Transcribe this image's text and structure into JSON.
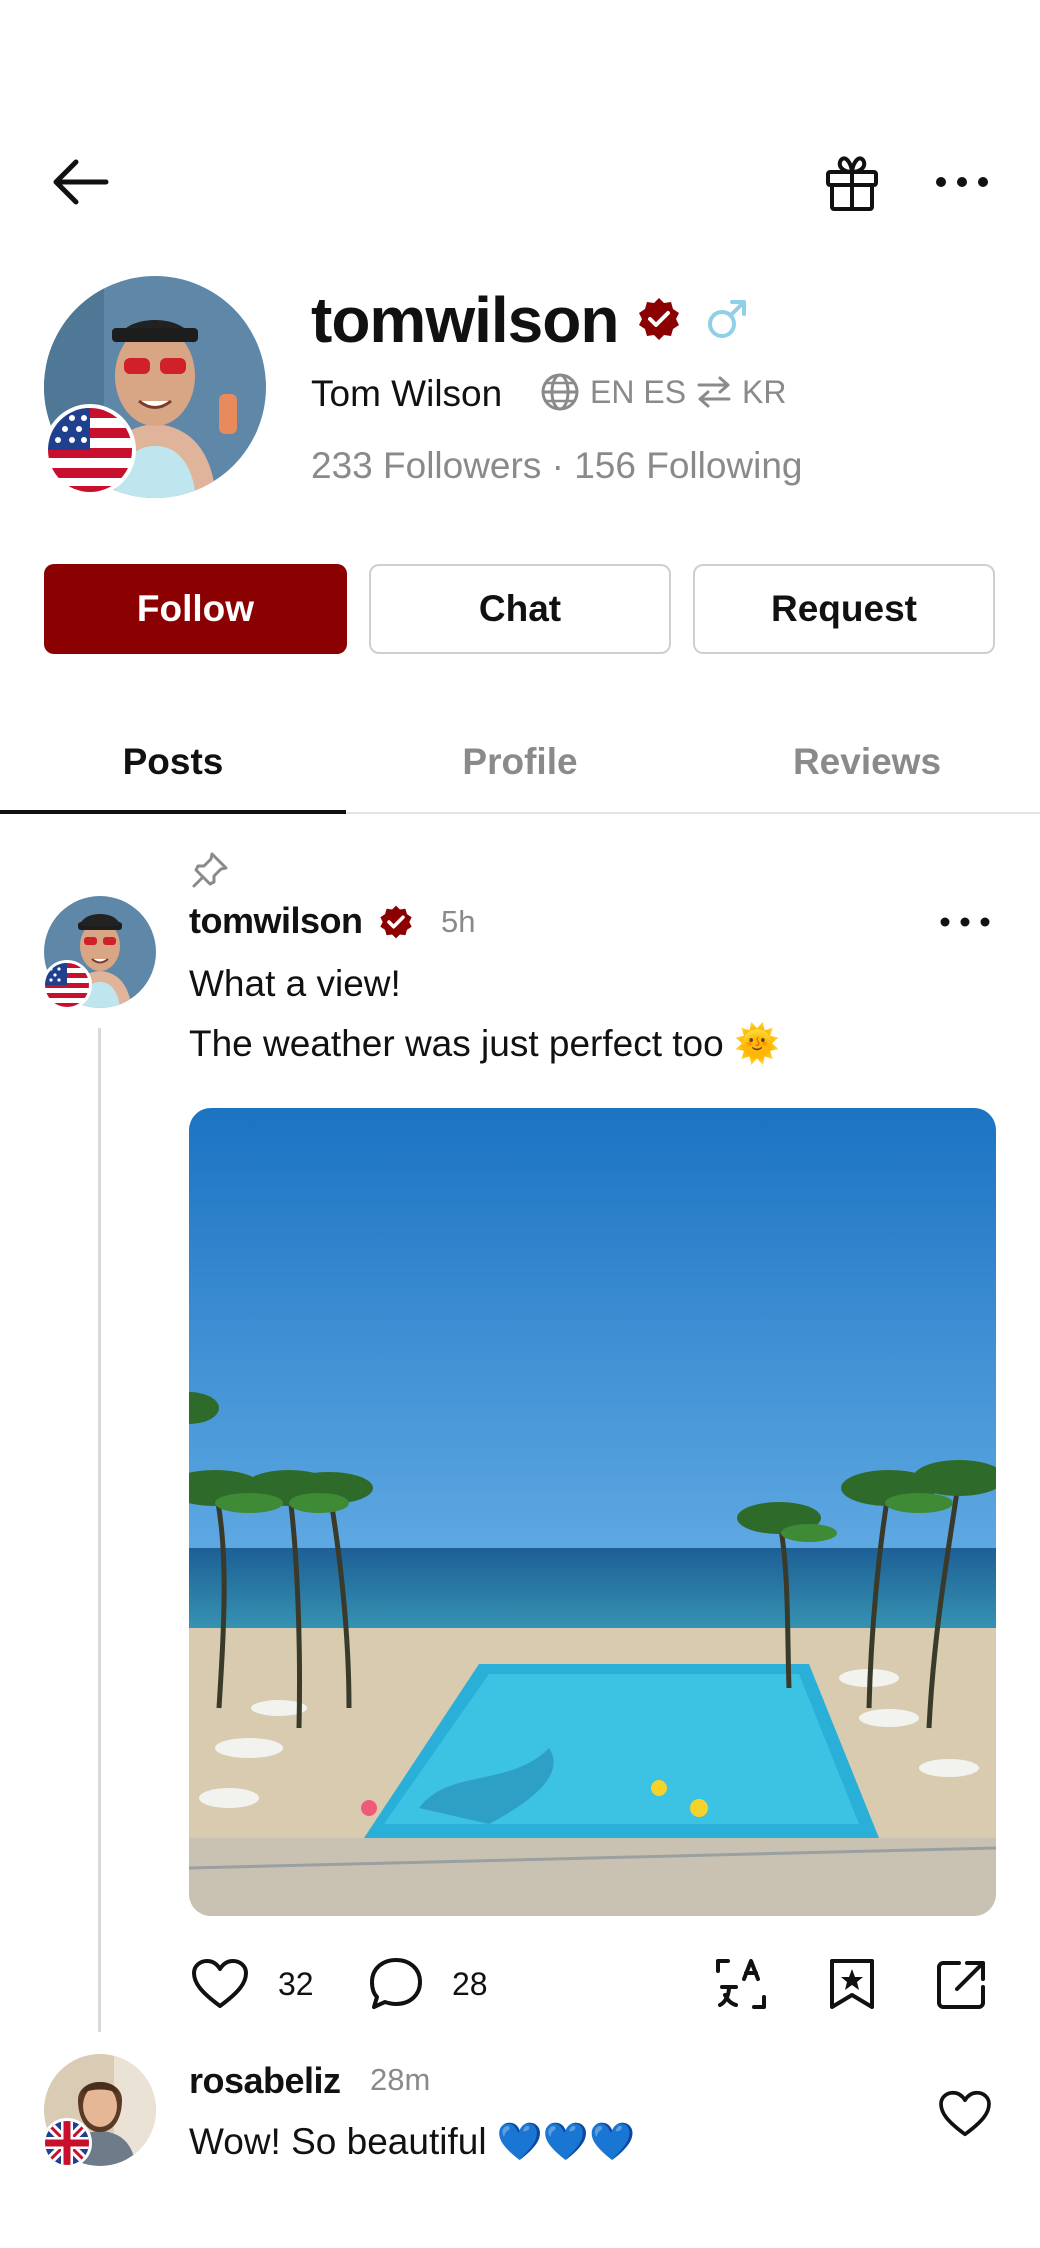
{
  "profile": {
    "username": "tomwilson",
    "full_name": "Tom Wilson",
    "languages": {
      "native": "EN ES",
      "learning": "KR"
    },
    "followers_text": "233 Followers · 156 Following"
  },
  "actions": {
    "follow": "Follow",
    "chat": "Chat",
    "request": "Request"
  },
  "tabs": [
    {
      "label": "Posts",
      "active": true
    },
    {
      "label": "Profile",
      "active": false
    },
    {
      "label": "Reviews",
      "active": false
    }
  ],
  "post": {
    "username": "tomwilson",
    "time": "5h",
    "line1": "What a view!",
    "line2": "The weather was just perfect too 🌞",
    "likes": "32",
    "comments": "28"
  },
  "reply": {
    "username": "rosabeliz",
    "time": "28m",
    "text": "Wow! So beautiful 💙💙💙"
  },
  "colors": {
    "accent": "#8b0000",
    "muted": "#8a8a8a",
    "border": "#cfcfcf"
  }
}
